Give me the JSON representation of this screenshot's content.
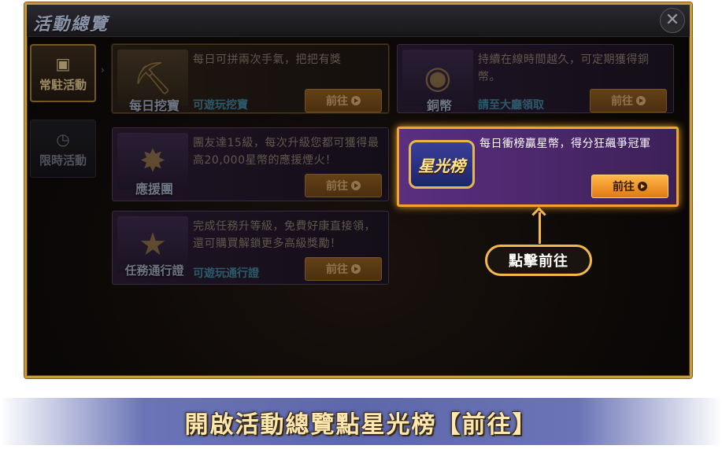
{
  "window": {
    "title": "活動總覽",
    "close_icon": "close-icon"
  },
  "sidebar": {
    "items": [
      {
        "label": "常駐活動",
        "icon": "grid-icon",
        "active": true
      },
      {
        "label": "限時活動",
        "icon": "timer-icon",
        "active": false
      }
    ]
  },
  "cards": [
    {
      "label": "每日挖寶",
      "icon": "shovel-icon",
      "desc": "每日可拼兩次手氣，把把有獎",
      "link": "可遊玩挖寶",
      "button": "前往"
    },
    {
      "label": "銅幣",
      "icon": "coin-icon",
      "desc": "持續在線時間越久，可定期獲得銅幣。",
      "link": "請至大廳領取",
      "button": "前往"
    },
    {
      "label": "應援團",
      "icon": "firework-icon",
      "desc": "團友達15級，每次升級您都可獲得最高20,000星幣的應援煙火！",
      "link": "",
      "button": "前往"
    },
    {
      "label": "星光榜",
      "icon": "star-badge-icon",
      "desc": "每日衝榜贏星幣，得分狂飆爭冠軍",
      "link": "",
      "button": "前往"
    },
    {
      "label": "任務通行證",
      "icon": "ticket-icon",
      "desc": "完成任務升等級，免費好康直接領，還可購買解鎖更多高級獎勵！",
      "link": "可遊玩通行證",
      "button": "前往"
    }
  ],
  "callout": "點擊前往",
  "banner": "開啟活動總覽點星光榜【前往】",
  "colors": {
    "highlight": "#f1a32a",
    "frame": "#c79a3a",
    "banner": "#5d67ab"
  }
}
